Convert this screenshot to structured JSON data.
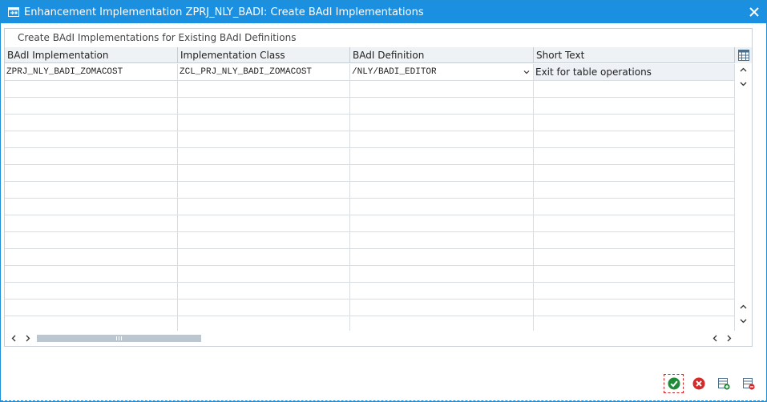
{
  "window": {
    "title": "Enhancement Implementation ZPRJ_NLY_BADI: Create BAdI Implementations",
    "accent_color": "#1b8fe0",
    "title_icon": "enhancement-icon",
    "close_icon": "close-icon"
  },
  "group": {
    "title": "Create BAdI Implementations for Existing BAdI Definitions"
  },
  "table": {
    "columns": [
      "BAdI Implementation",
      "Implementation Class",
      "BAdI Definition",
      "Short Text"
    ],
    "rows": [
      {
        "implementation": "ZPRJ_NLY_BADI_ZOMACOST",
        "class": "ZCL_PRJ_NLY_BADI_ZOMACOST",
        "definition": "/NLY/BADI_EDITOR",
        "short_text": "Exit for table operations"
      }
    ],
    "empty_rows": 15,
    "settings_icon": "table-settings-icon"
  },
  "footer": {
    "buttons": [
      {
        "name": "confirm-button",
        "icon": "check-icon"
      },
      {
        "name": "cancel-button",
        "icon": "cancel-icon"
      },
      {
        "name": "insert-row-button",
        "icon": "insert-row-icon"
      },
      {
        "name": "delete-row-button",
        "icon": "delete-row-icon"
      }
    ]
  }
}
